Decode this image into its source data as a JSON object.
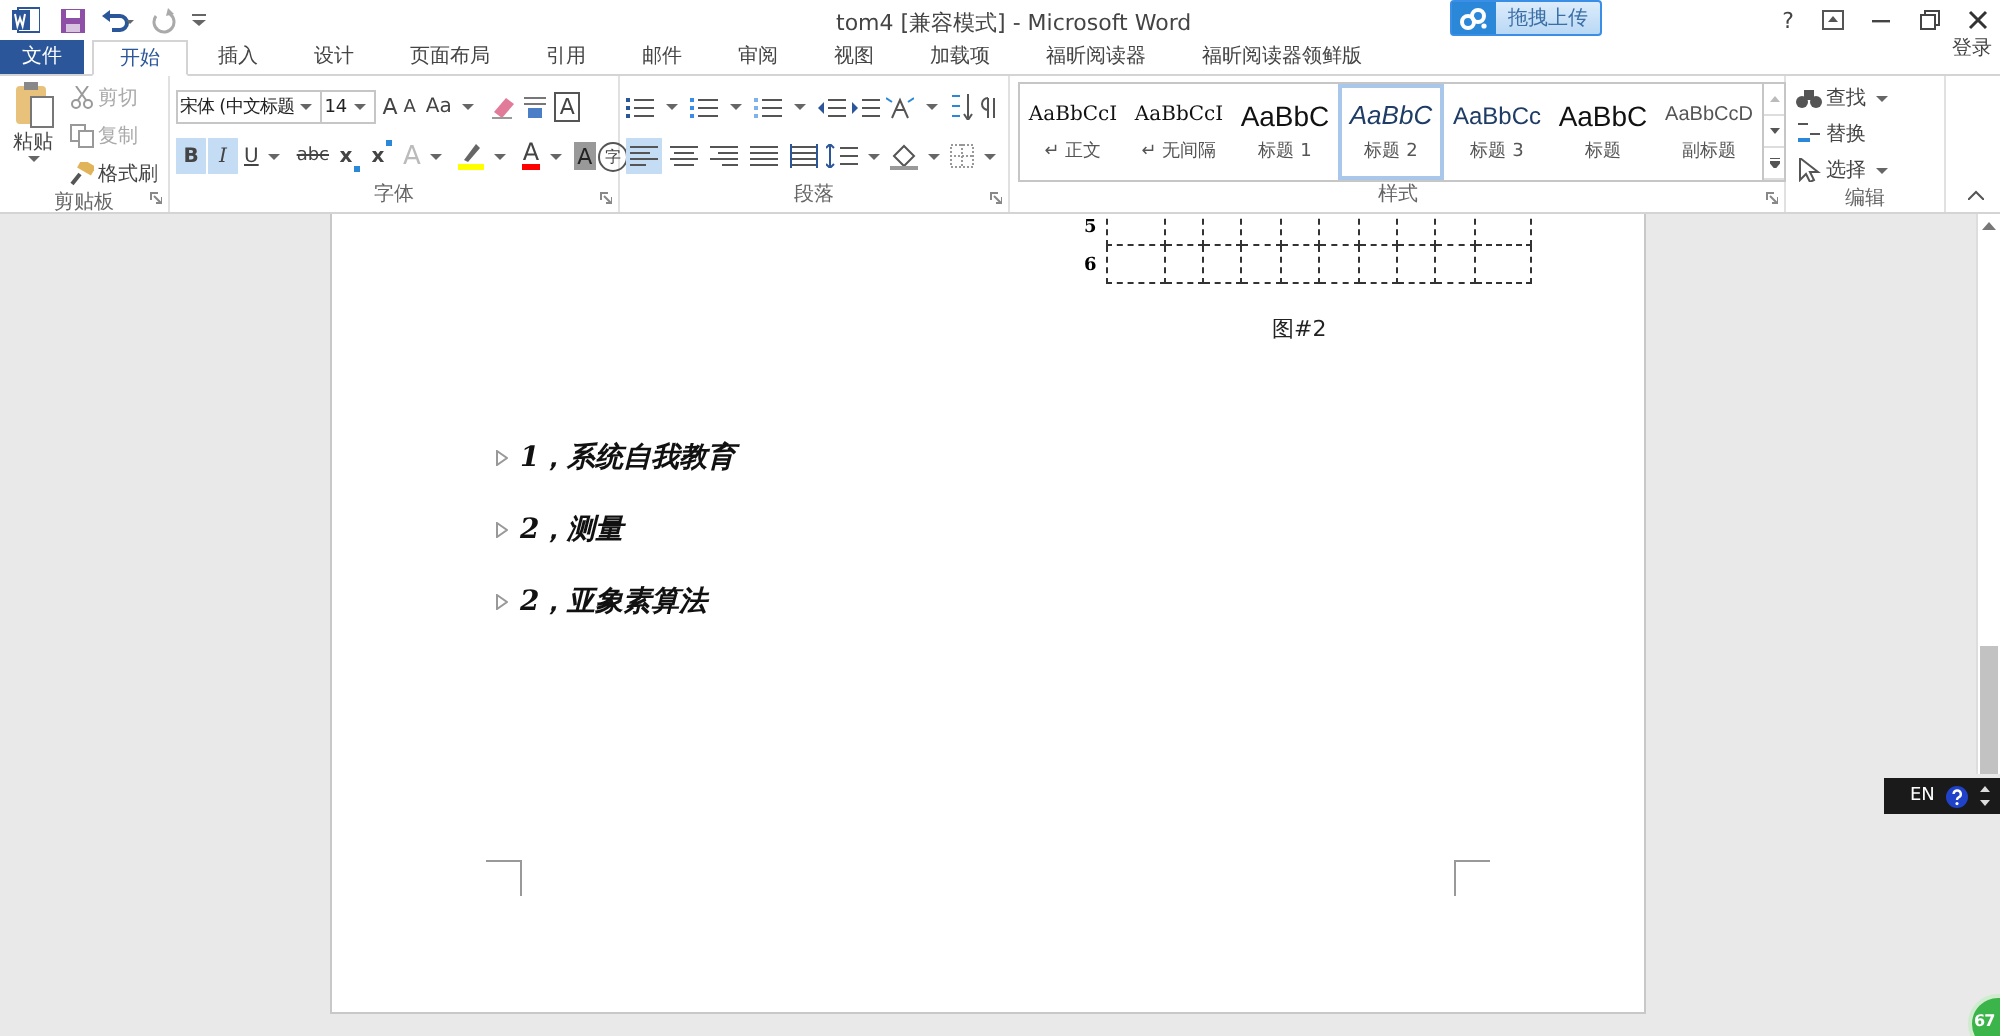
{
  "title_bar": {
    "title": "tom4 [兼容模式] - Microsoft Word",
    "upload_button": "拖拽上传",
    "help": "?"
  },
  "tabs": [
    {
      "label": "文件",
      "kind": "file",
      "selected": false
    },
    {
      "label": "开始",
      "kind": "tab",
      "selected": true
    },
    {
      "label": "插入",
      "kind": "tab",
      "selected": false
    },
    {
      "label": "设计",
      "kind": "tab",
      "selected": false
    },
    {
      "label": "页面布局",
      "kind": "tab",
      "selected": false
    },
    {
      "label": "引用",
      "kind": "tab",
      "selected": false
    },
    {
      "label": "邮件",
      "kind": "tab",
      "selected": false
    },
    {
      "label": "审阅",
      "kind": "tab",
      "selected": false
    },
    {
      "label": "视图",
      "kind": "tab",
      "selected": false
    },
    {
      "label": "加载项",
      "kind": "tab",
      "selected": false
    },
    {
      "label": "福昕阅读器",
      "kind": "tab",
      "selected": false
    },
    {
      "label": "福昕阅读器领鲜版",
      "kind": "tab",
      "selected": false
    }
  ],
  "sign_in": "登录",
  "clipboard": {
    "label": "剪贴板",
    "paste": "粘贴",
    "commands": [
      {
        "label": "剪切",
        "kind": "cut",
        "disabled": true
      },
      {
        "label": "复制",
        "kind": "copy",
        "disabled": true
      },
      {
        "label": "格式刷",
        "kind": "painter",
        "disabled": false
      }
    ]
  },
  "font": {
    "label": "字体",
    "font_name": "宋体 (中文标题",
    "font_size": "14",
    "grow": "A",
    "shrink": "A",
    "case": "Aa",
    "border": "A",
    "formats": [
      {
        "text": "B",
        "kind": "bold",
        "selected": true
      },
      {
        "text": "I",
        "kind": "italic",
        "selected": true
      },
      {
        "text": "U",
        "kind": "underline",
        "selected": false
      },
      {
        "text": "abc",
        "kind": "strike",
        "selected": false
      },
      {
        "text": "x",
        "kind": "sub",
        "selected": false
      },
      {
        "text": "x",
        "kind": "sup",
        "selected": false
      }
    ],
    "effects": [
      {
        "text": "A",
        "kind": "effect"
      },
      {
        "kind": "highlight",
        "color": "#ffff00"
      },
      {
        "text": "A",
        "kind": "color",
        "color": "#ff0000"
      },
      {
        "text": "A",
        "kind": "shading"
      },
      {
        "text": "字",
        "kind": "enclose"
      }
    ]
  },
  "paragraph": {
    "label": "段落",
    "align": [
      {
        "kind": "left",
        "selected": true
      },
      {
        "kind": "center",
        "selected": false
      },
      {
        "kind": "right",
        "selected": false
      },
      {
        "kind": "justify",
        "selected": false
      },
      {
        "kind": "distribute",
        "selected": false
      }
    ]
  },
  "styles": {
    "label": "样式",
    "items": [
      {
        "preview": "AaBbCcI",
        "name": "↵ 正文",
        "kind": "normal",
        "selected": false
      },
      {
        "preview": "AaBbCcI",
        "name": "↵ 无间隔",
        "kind": "normal",
        "selected": false
      },
      {
        "preview": "AaBbC",
        "name": "标题 1",
        "kind": "heading",
        "selected": false
      },
      {
        "preview": "AaBbC",
        "name": "标题 2",
        "kind": "italic",
        "selected": true
      },
      {
        "preview": "AaBbCc",
        "name": "标题 3",
        "kind": "sans",
        "selected": false
      },
      {
        "preview": "AaBbC",
        "name": "标题",
        "kind": "heading",
        "selected": false
      },
      {
        "preview": "AaBbCcD",
        "name": "副标题",
        "kind": "light",
        "selected": false
      }
    ]
  },
  "editing": {
    "label": "编辑",
    "commands": [
      {
        "label": "查找",
        "kind": "find"
      },
      {
        "label": "替换",
        "kind": "replace"
      },
      {
        "label": "选择",
        "kind": "select"
      }
    ]
  },
  "document": {
    "table_rows": [
      {
        "number": "5"
      },
      {
        "number": "6"
      }
    ],
    "caption": "图#2",
    "headings": [
      "1，系统自我教育",
      "2，测量",
      "2，亚象素算法"
    ]
  },
  "language_bar": {
    "label": "EN"
  },
  "badge": "67"
}
